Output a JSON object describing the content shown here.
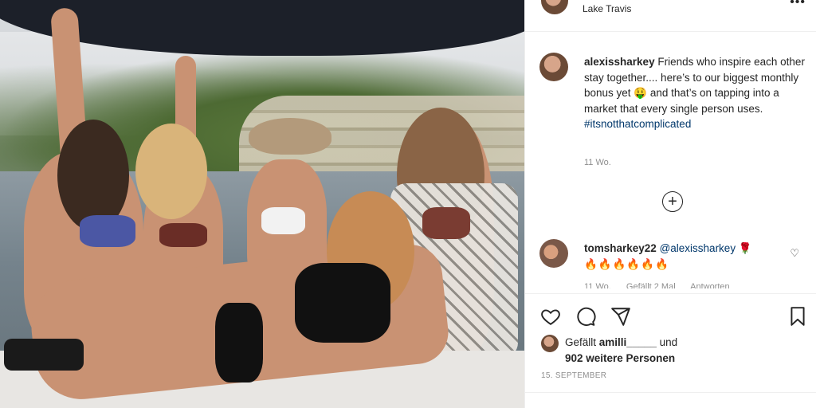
{
  "post": {
    "location": "Lake Travis",
    "more_icon": "more-horizontal-icon",
    "caption": {
      "username": "alexissharkey",
      "text": "Friends who inspire each other stay together.... here’s to our biggest monthly bonus yet",
      "text2": "and that’s on tapping into a market that every single person uses.",
      "hashtag": "#itsnotthatcomplicated",
      "time": "11 Wo."
    },
    "load_more_icon": "plus-circle-icon",
    "comment": {
      "username": "tomsharkey22",
      "mention": "@alexissharkey",
      "emoji_rose": "🌹",
      "emoji_fire": "🔥🔥🔥🔥🔥🔥",
      "time": "11 Wo.",
      "likes": "Gefällt 2 Mal",
      "reply": "Antworten"
    },
    "actions": [
      "heart-icon",
      "comment-icon",
      "share-icon",
      "bookmark-icon"
    ],
    "likes": {
      "prefix": "Gefällt",
      "user": "amilli_____",
      "und": "und",
      "others": "902 weitere Personen"
    },
    "date": "15. SEPTEMBER"
  },
  "colors": {
    "link": "#00376b",
    "muted": "#8e8e8e",
    "text": "#262626"
  }
}
